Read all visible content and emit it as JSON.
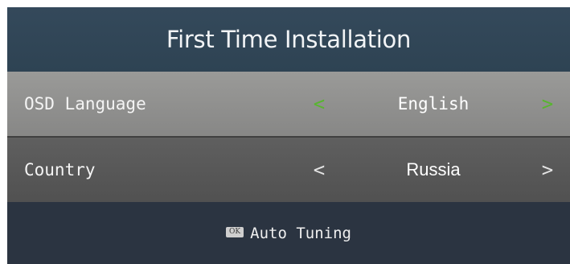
{
  "header": {
    "title": "First Time Installation"
  },
  "settings": {
    "osd_language": {
      "label": "OSD Language",
      "left_arrow": "<",
      "value": "English",
      "right_arrow": ">"
    },
    "country": {
      "label": "Country",
      "left_arrow": "<",
      "value": "Russia",
      "right_arrow": ">"
    }
  },
  "footer": {
    "ok_key": "OK",
    "action_label": "Auto Tuning"
  },
  "colors": {
    "title_bar": "#34495b",
    "selected_row": "#9a9a98",
    "unselected_row": "#5f5f5f",
    "background": "#2b3441",
    "selected_arrow": "#58b52f"
  },
  "state": {
    "selected_row": "osd_language"
  }
}
